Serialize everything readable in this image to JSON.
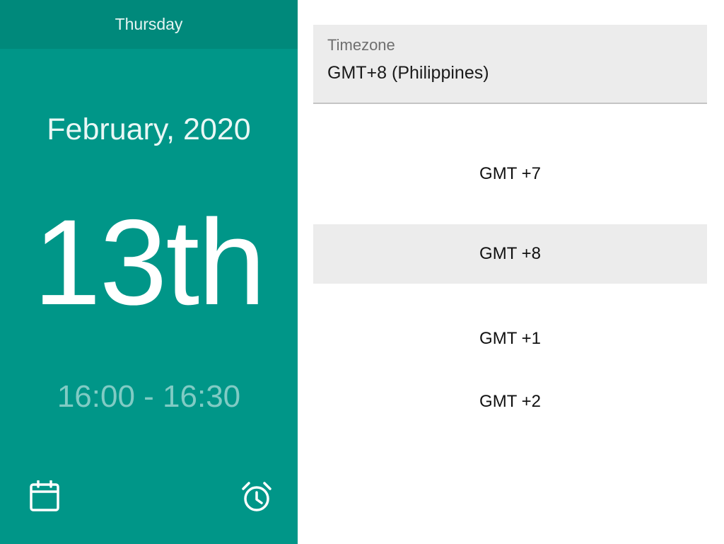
{
  "left_panel": {
    "day_name": "Thursday",
    "month_year": "February, 2020",
    "day_number": "13th",
    "time_range": "16:00 - 16:30",
    "icons": {
      "calendar": "calendar-icon",
      "alarm": "alarm-clock-icon"
    }
  },
  "timezone": {
    "label": "Timezone",
    "value": "GMT+8 (Philippines)",
    "options": [
      {
        "label": "GMT +7",
        "selected": false
      },
      {
        "label": "GMT +8",
        "selected": true
      },
      {
        "label": "GMT +1",
        "selected": false
      },
      {
        "label": "GMT +2",
        "selected": false
      }
    ]
  },
  "colors": {
    "primary": "#009688",
    "primary_dark": "#00897b",
    "muted_text": "#80cbc4",
    "field_bg": "#ececec"
  }
}
